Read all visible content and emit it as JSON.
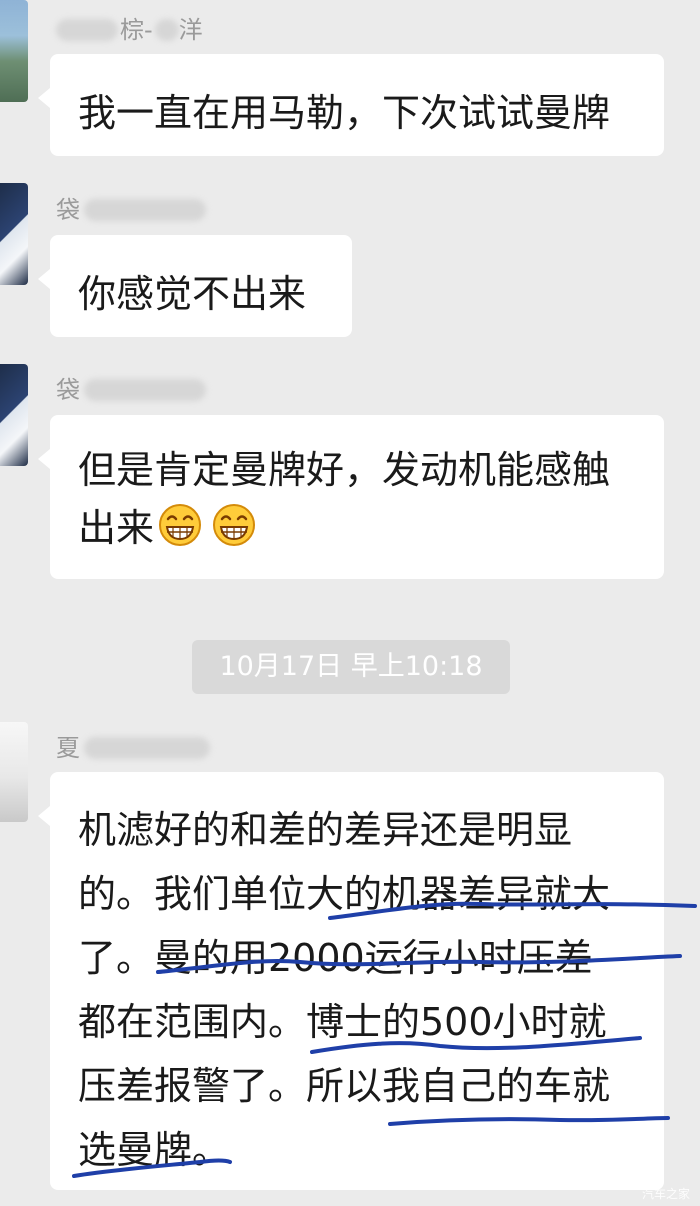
{
  "messages": [
    {
      "sender": "棕-",
      "sender_suffix": "洋",
      "text": "我一直在用马勒，下次试试曼牌"
    },
    {
      "sender": "袋",
      "text": "你感觉不出来"
    },
    {
      "sender": "袋",
      "text_line1": "但是肯定曼牌好，发动机能感触",
      "text_line2": "出来",
      "emoji": "grin-emoji"
    },
    {
      "sender": "夏",
      "lines": [
        "机滤好的和差的差异还是明显",
        "的。我们单位大的机器差异就大",
        "了。曼的用2000运行小时压差",
        "都在范围内。博士的500小时就",
        "压差报警了。所以我自己的车就",
        "选曼牌。"
      ]
    }
  ],
  "timestamp": "10月17日 早上10:18",
  "watermark": "汽车之家",
  "colors": {
    "background": "#ebebeb",
    "bubble": "#ffffff",
    "annotation_ink": "#1f3fa8",
    "timestamp_bg": "#d9d9d9"
  }
}
